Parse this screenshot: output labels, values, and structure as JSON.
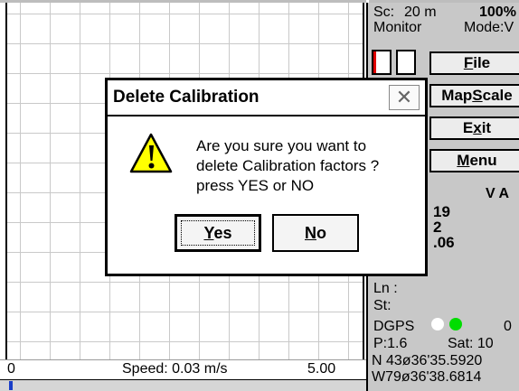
{
  "map": {
    "speed_label": "Speed: 0.03 m/s",
    "speed_min": "0",
    "speed_max": "5.00",
    "speed_fraction": 0.01
  },
  "panel": {
    "scale_label": "Sc:",
    "scale_value": "20 m",
    "zoom": "100%",
    "monitor": "Monitor",
    "mode": "Mode:V",
    "buttons": [
      {
        "label": "File",
        "key": "F",
        "rest": "ile"
      },
      {
        "label": "MapScale",
        "pre": "Map",
        "key": "S",
        "rest": "cale"
      },
      {
        "label": "Exit",
        "pre": "E",
        "key": "x",
        "rest": "it"
      },
      {
        "label": "Menu",
        "key": "M",
        "rest": "enu"
      }
    ],
    "va_label": "V A",
    "value1": "19",
    "value2": "2",
    "value3": ".06",
    "ln_label": "Ln :",
    "st_label": "St:",
    "dgps_label": "DGPS",
    "dgps_count": "0",
    "pdop": "P:1.6",
    "sat": "Sat: 10",
    "lat": "N 43ø36'35.5920",
    "lon": "W79ø36'38.6814",
    "colors": {
      "dgps_off": "#ffffff",
      "dgps_on": "#00dd00"
    }
  },
  "dialog": {
    "title": "Delete Calibration",
    "close_glyph": "✕",
    "icon": "warning-icon",
    "message_lines": [
      "Are you sure you want to",
      "delete Calibration factors ?",
      "press  YES  or  NO"
    ],
    "yes_key": "Y",
    "yes_rest": "es",
    "no_key": "N",
    "no_rest": "o"
  }
}
